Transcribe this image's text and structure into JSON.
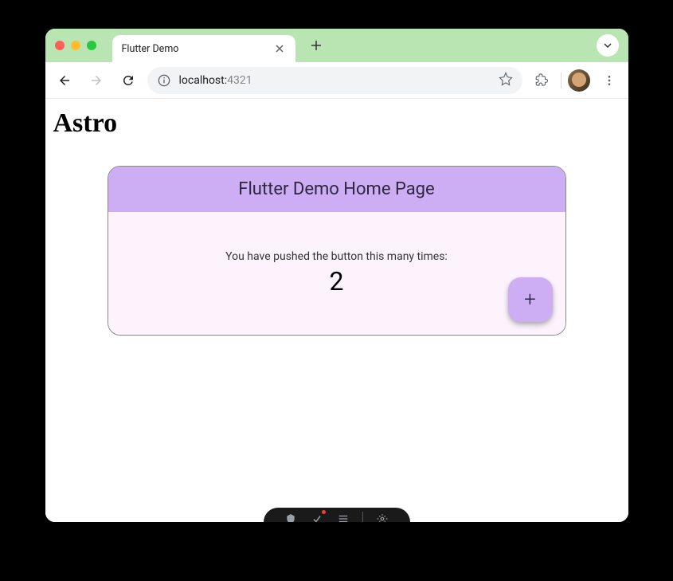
{
  "tab": {
    "title": "Flutter Demo"
  },
  "url": {
    "host": "localhost:",
    "port": "4321"
  },
  "page": {
    "heading": "Astro"
  },
  "card": {
    "title": "Flutter Demo Home Page",
    "counter_text": "You have pushed the button this many times:",
    "counter_value": "2"
  }
}
